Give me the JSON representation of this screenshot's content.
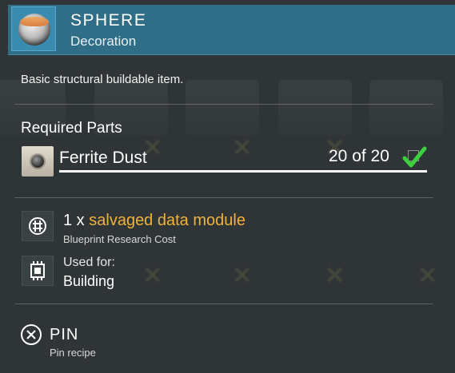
{
  "header": {
    "title": "SPHERE",
    "subtitle": "Decoration",
    "icon": "sphere-icon"
  },
  "description": "Basic structural buildable item.",
  "required_parts": {
    "title": "Required Parts",
    "items": [
      {
        "name": "Ferrite Dust",
        "count_text": "20 of 20",
        "progress": 1.0,
        "complete": true,
        "icon": "ferrite-dust-icon"
      }
    ]
  },
  "research": {
    "prefix": "1 x",
    "item": "salvaged data module",
    "caption": "Blueprint Research Cost",
    "icon": "data-module-icon",
    "highlight_color": "#f0b23a"
  },
  "usage": {
    "label": "Used for:",
    "value": "Building",
    "icon": "circuit-chip-icon"
  },
  "pin": {
    "label": "PIN",
    "caption": "Pin recipe",
    "icon": "close-circle-icon"
  },
  "colors": {
    "header_bg": "#2f6e86",
    "panel_bg": "#2f3536",
    "check": "#3ecf3e"
  }
}
